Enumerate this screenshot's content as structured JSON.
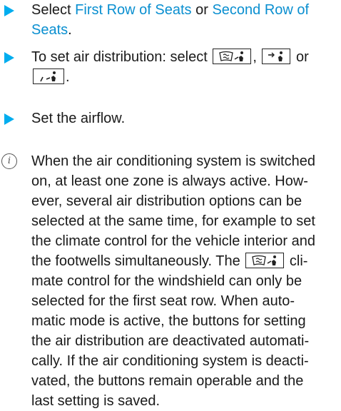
{
  "steps": [
    {
      "pre": "Select ",
      "option1": "First Row of Seats",
      "mid": " or ",
      "option2": "Second Row of Seats",
      "post": "."
    },
    {
      "pre": "To set air distribution: select ",
      "sep1": ", ",
      "sep2": " or",
      "post": "."
    },
    {
      "text": "Set the airflow."
    }
  ],
  "note": {
    "lines": [
      "When the air conditioning system is switched",
      "on, at least one zone is always active. How-",
      "ever, several air distribution options can be",
      "selected at the same time, for example to set",
      "the climate control for the vehicle interior and",
      "the footwells simultaneously. The",
      "cli-",
      "mate control for the windshield can only be",
      "selected for the first seat row. When auto-",
      "matic mode is active, the buttons for setting",
      "the air distribution are deactivated automati-",
      "cally. If the air conditioning system is deacti-",
      "vated, the buttons remain operable and the",
      "last setting is saved."
    ]
  },
  "icons": {
    "bullet": "triangle-bullet-icon",
    "info": "info-icon",
    "windshield_button": "windshield-airflow-icon",
    "center_button": "center-vent-airflow-icon",
    "footwell_button": "footwell-airflow-icon"
  },
  "colors": {
    "bullet": "#00adef",
    "link": "#0a8fd0",
    "text": "#1a1a1a"
  }
}
